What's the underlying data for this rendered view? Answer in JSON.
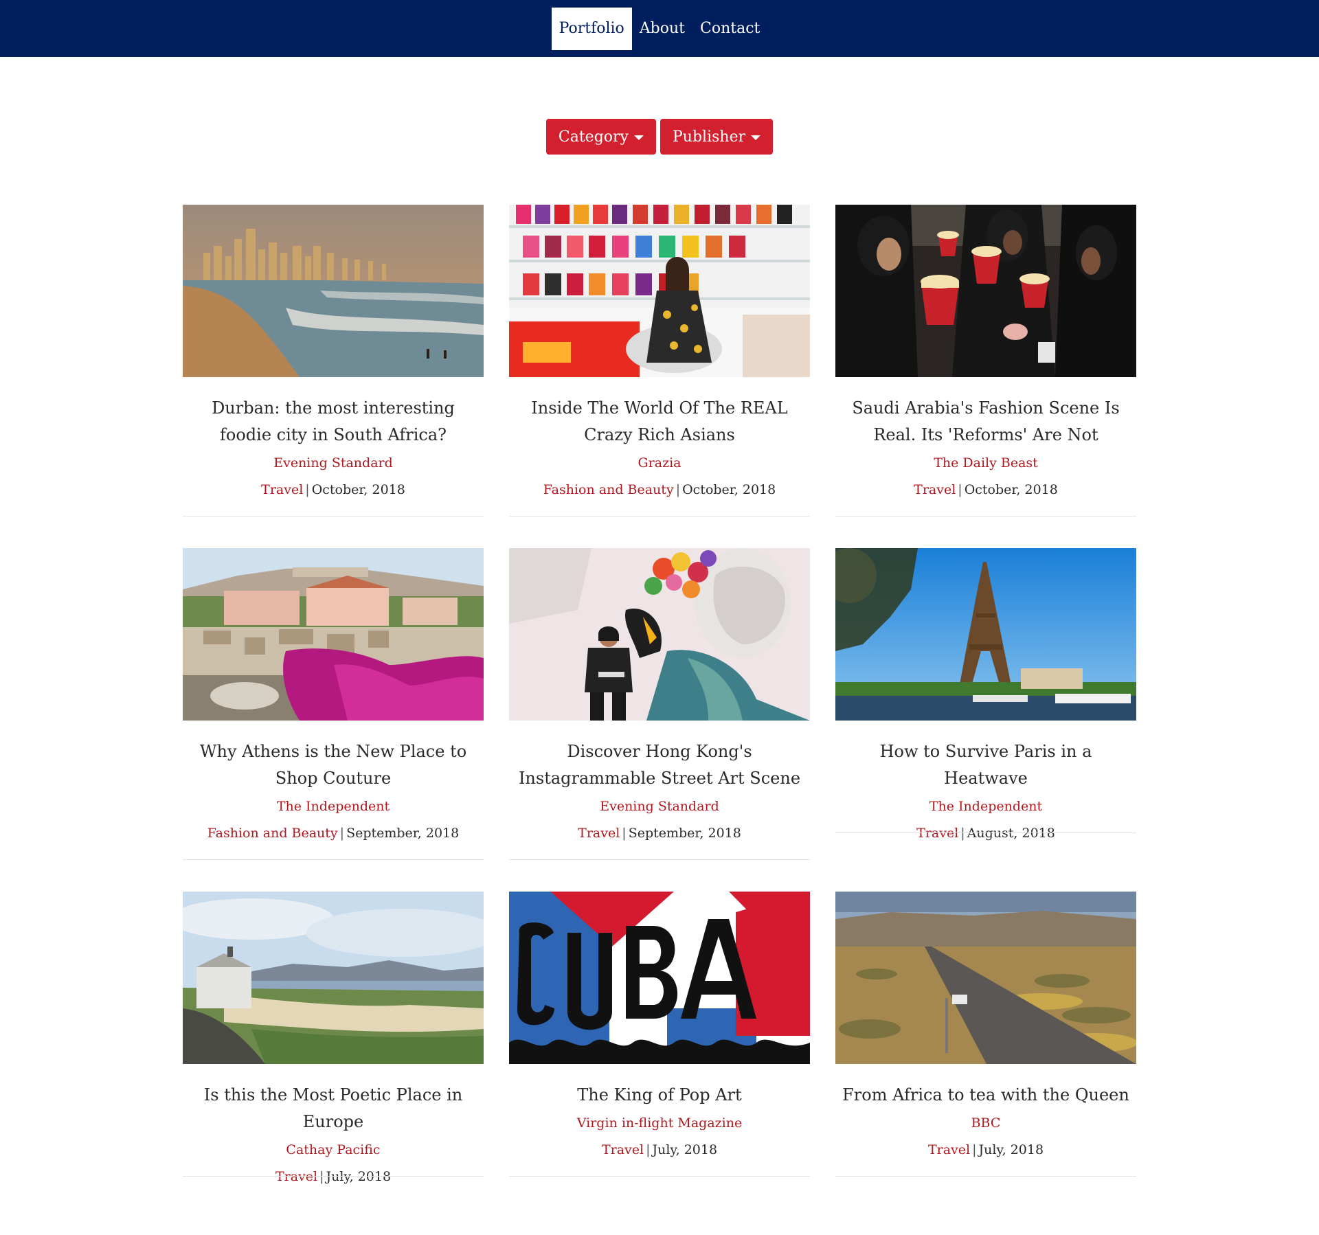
{
  "nav": {
    "items": [
      {
        "label": "Portfolio",
        "active": true
      },
      {
        "label": "About",
        "active": false
      },
      {
        "label": "Contact",
        "active": false
      }
    ]
  },
  "filters": {
    "category_label": "Category",
    "publisher_label": "Publisher",
    "accent_color": "#d3202f"
  },
  "articles": [
    {
      "title": "Durban: the most interesting foodie city in South Africa?",
      "publisher": "Evening Standard",
      "category": "Travel",
      "date": "October, 2018",
      "image": "durban-beach-skyline"
    },
    {
      "title": "Inside The World Of The REAL Crazy Rich Asians",
      "publisher": "Grazia",
      "category": "Fashion and Beauty",
      "date": "October, 2018",
      "image": "woman-handbag-wall"
    },
    {
      "title": "Saudi Arabia's Fashion Scene Is Real. Its 'Reforms' Are Not",
      "publisher": "The Daily Beast",
      "category": "Travel",
      "date": "October, 2018",
      "image": "women-popcorn-cinema"
    },
    {
      "title": "Why Athens is the New Place to Shop Couture",
      "publisher": "The Independent",
      "category": "Fashion and Beauty",
      "date": "September, 2018",
      "image": "athens-ruins-bougainvillea"
    },
    {
      "title": "Discover Hong Kong's Instagrammable Street Art Scene",
      "publisher": "Evening Standard",
      "category": "Travel",
      "date": "September, 2018",
      "image": "street-art-mural"
    },
    {
      "title": "How to Survive Paris in a Heatwave",
      "publisher": "The Independent",
      "category": "Travel",
      "date": "August, 2018",
      "image": "eiffel-tower"
    },
    {
      "title": "Is this the Most Poetic Place in Europe",
      "publisher": "Cathay Pacific",
      "category": "Travel",
      "date": "July, 2018",
      "image": "coastal-cottage"
    },
    {
      "title": "The King of Pop Art",
      "publisher": "Virgin in-flight Magazine",
      "category": "Travel",
      "date": "July, 2018",
      "image": "cuba-pop-art"
    },
    {
      "title": "From Africa to tea with the Queen",
      "publisher": "BBC",
      "category": "Travel",
      "date": "July, 2018",
      "image": "desert-road"
    }
  ]
}
